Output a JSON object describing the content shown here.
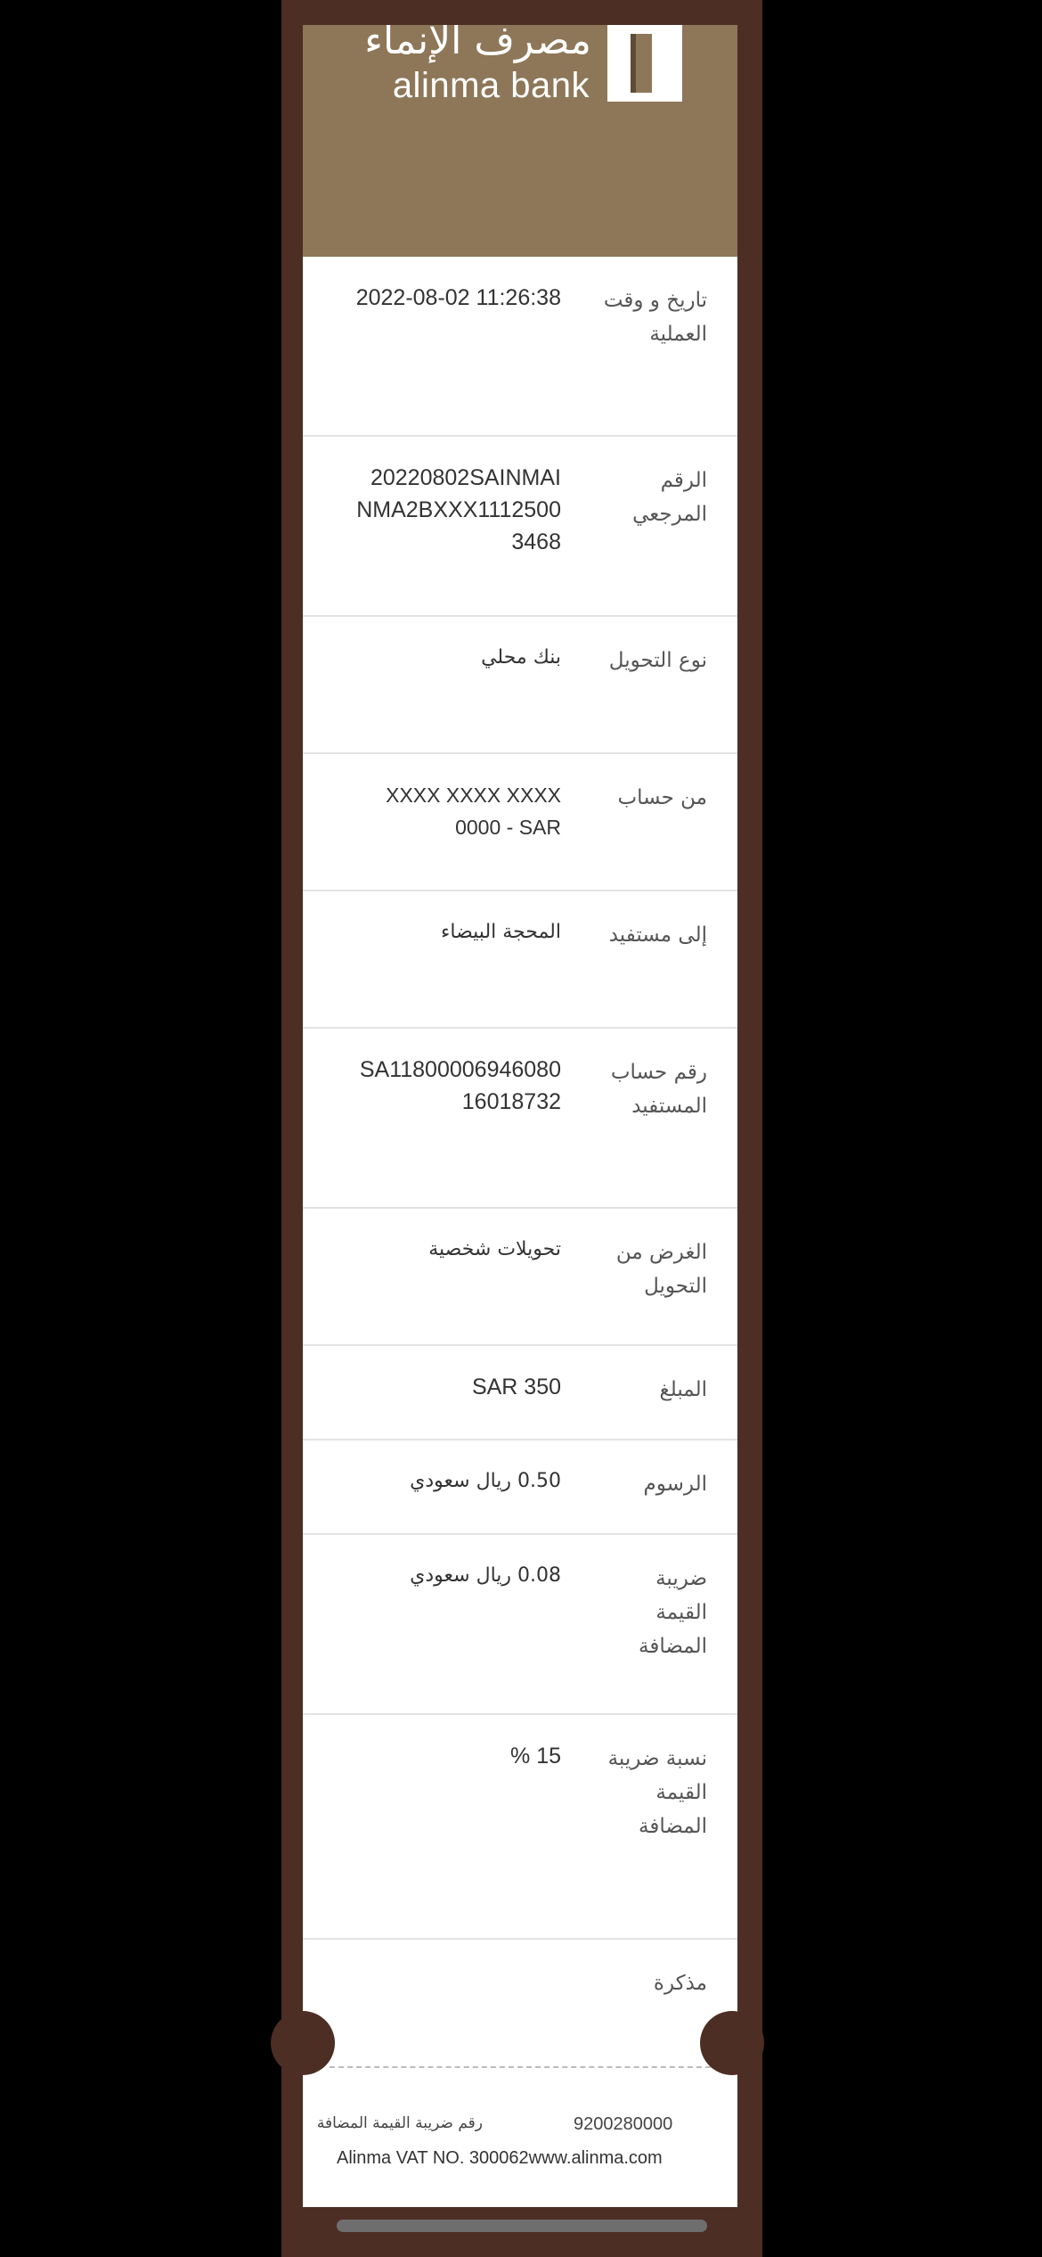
{
  "bank": {
    "name_ar": "مصرف الإنماء",
    "name_en": "alinma bank",
    "brand_color": "#8d7758",
    "frame_color": "#4d2e24"
  },
  "rows": [
    {
      "label": "تاريخ و وقت العملية",
      "value": "2022-08-02 11:26:38"
    },
    {
      "label": "الرقم المرجعي",
      "value": "20220802SAINMAINMA2BXXX11125003468"
    },
    {
      "label": "نوع التحويل",
      "value": "بنك محلي"
    },
    {
      "label": "من حساب",
      "value": "XXXX XXXX XXXX 0000 - SAR"
    },
    {
      "label": "إلى مستفيد",
      "value": "المحجة البيضاء"
    },
    {
      "label": "رقم حساب المستفيد",
      "value": "SA1180000694608016018732"
    },
    {
      "label": "الغرض من التحويل",
      "value": "تحويلات شخصية"
    },
    {
      "label": "المبلغ",
      "value": "SAR 350"
    },
    {
      "label": "الرسوم",
      "value": "0.50 ريال سعودي"
    },
    {
      "label": "ضريبة القيمة المضافة",
      "value": "0.08 ريال سعودي"
    },
    {
      "label": "نسبة ضريبة القيمة المضافة",
      "value": "% 15"
    },
    {
      "label": "مذكرة",
      "value": ""
    }
  ],
  "footer": {
    "vat_label_ar": "رقم ضريبة القيمة المضافة",
    "vat_number": "9200280000",
    "vat_en_line": "Alinma VAT NO. 300062www.alinma.com"
  }
}
